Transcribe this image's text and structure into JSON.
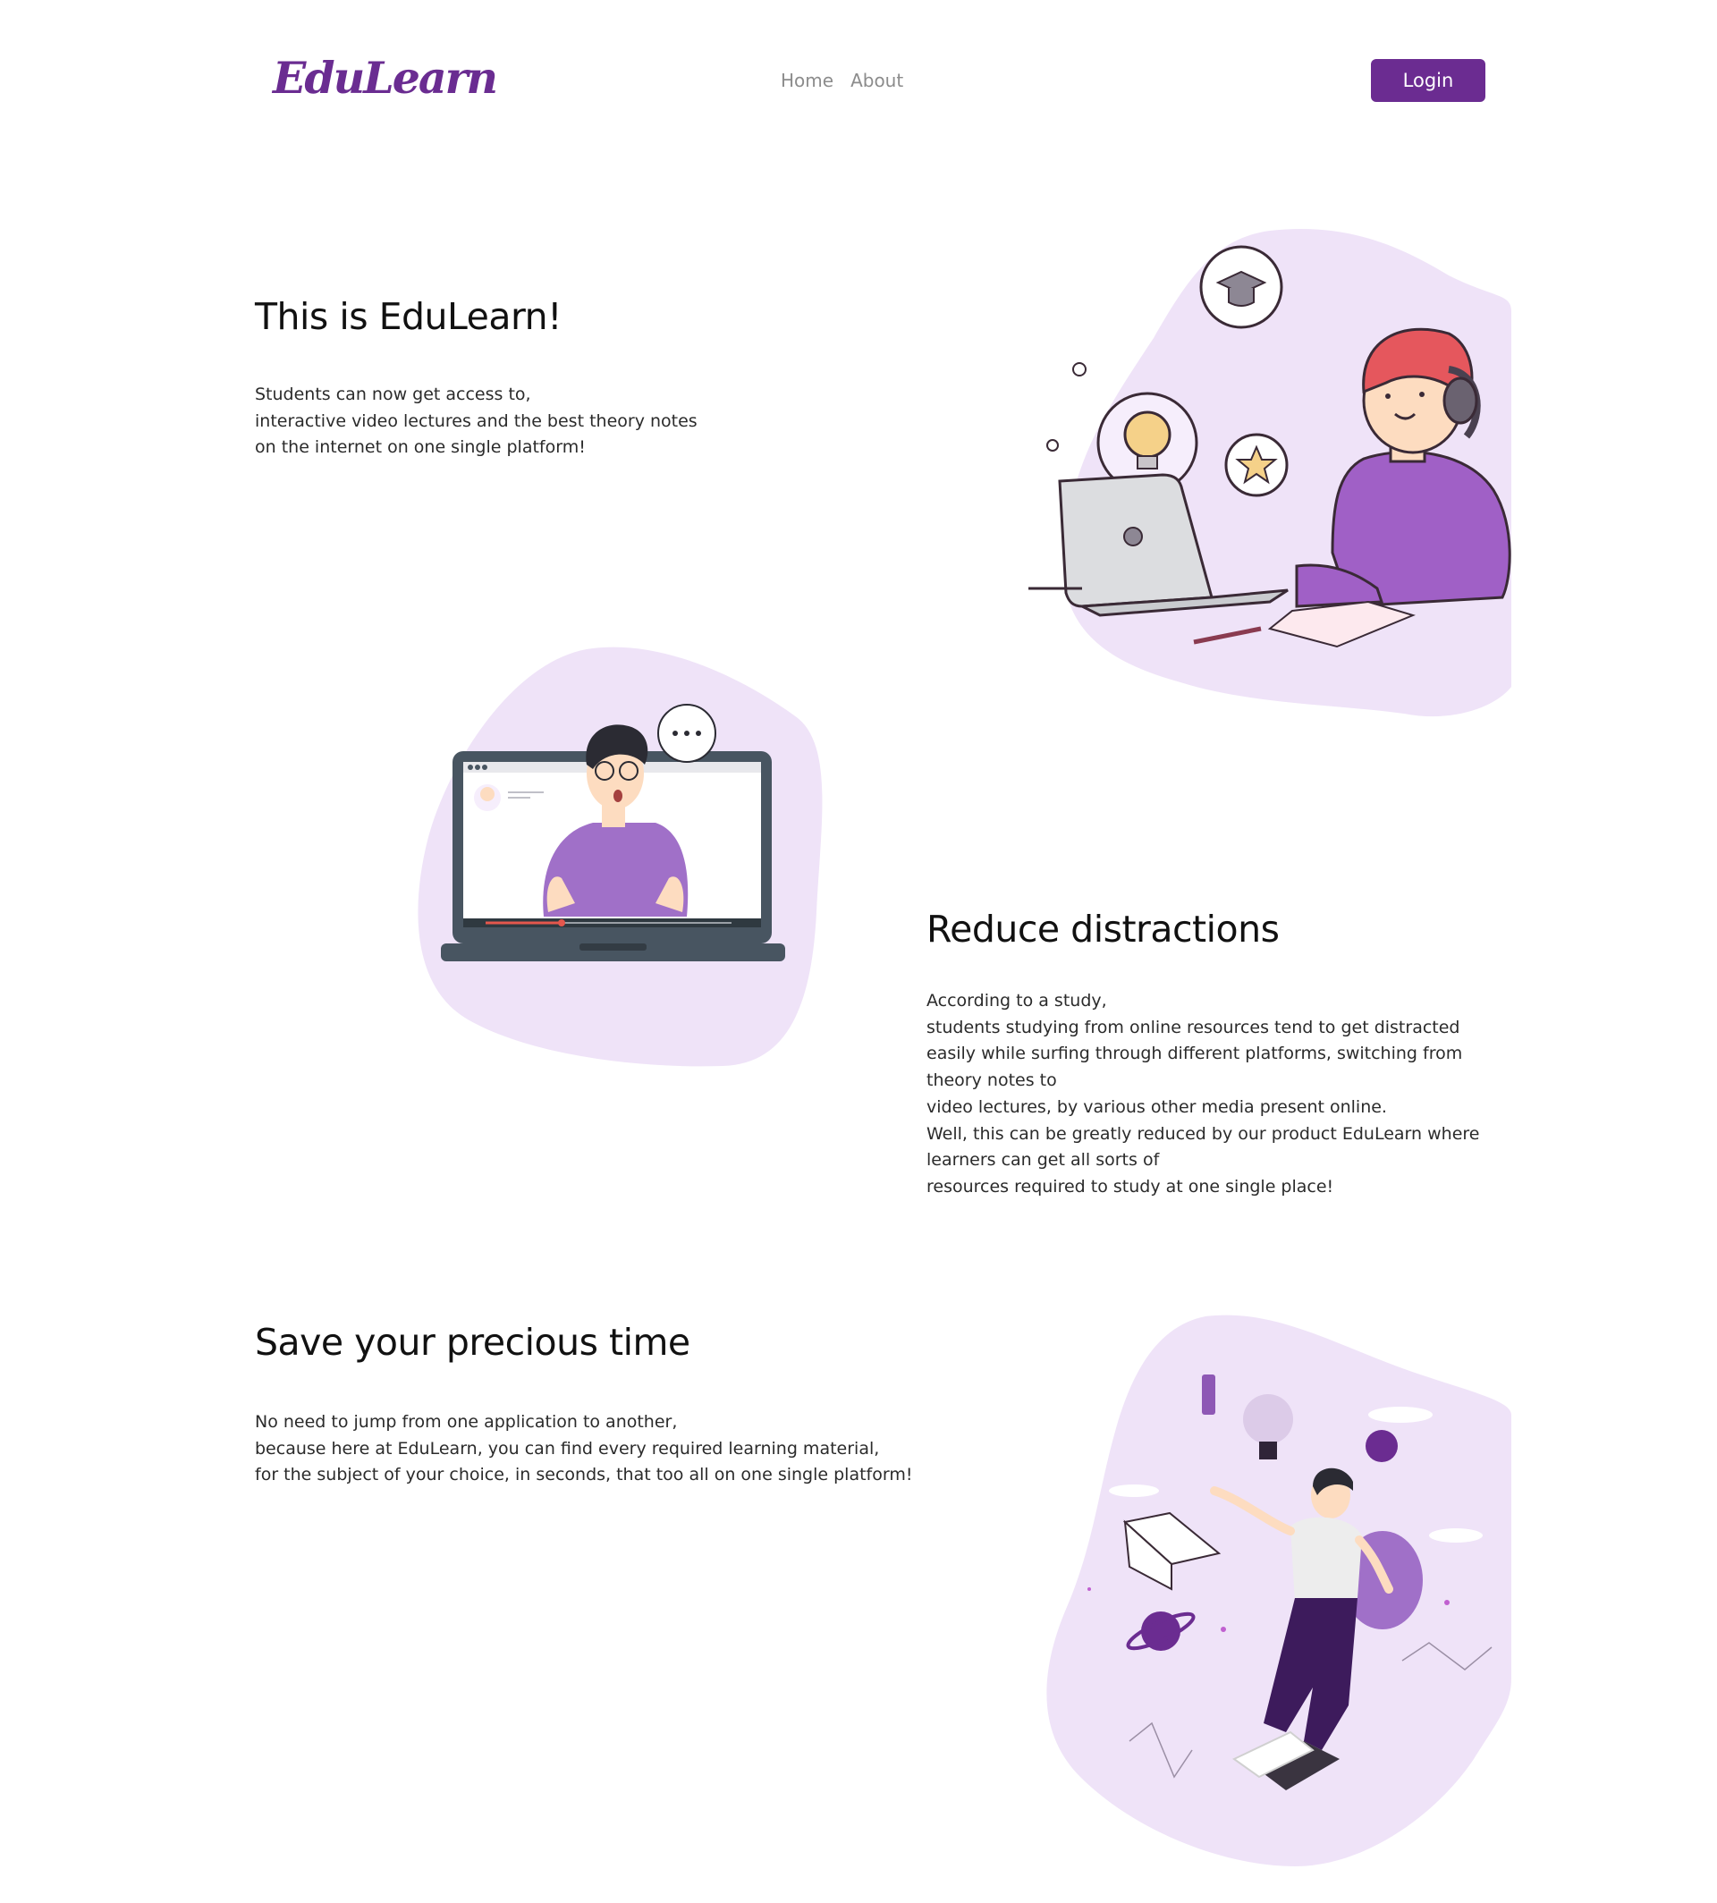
{
  "navbar": {
    "brand": "EduLearn",
    "links": [
      {
        "label": "Home"
      },
      {
        "label": "About"
      }
    ],
    "login_label": "Login",
    "accent_color": "#6b2c91"
  },
  "sections": [
    {
      "title": "This is EduLearn!",
      "lines": [
        "Students can now get access to,",
        "interactive video lectures and the best theory notes",
        "on the internet on one single platform!"
      ],
      "illustration": "student-with-headphones-at-laptop-illustration"
    },
    {
      "title": "Reduce distractions",
      "lines": [
        "According to a study,",
        "students studying from online resources tend to get distracted",
        "easily while surfing through different platforms, switching from",
        "theory notes to",
        "video lectures, by various other media present online.",
        "Well, this can be greatly reduced by our product EduLearn where",
        "learners can get all sorts of",
        "resources required to study at one single place!"
      ],
      "illustration": "video-lecture-on-laptop-illustration"
    },
    {
      "title": "Save your precious time",
      "lines": [
        "No need to jump from one application to another,",
        "because here at EduLearn, you can find every required learning material,",
        "for the subject of your choice, in seconds, that too all on one single platform!"
      ],
      "illustration": "floating-man-with-ideas-illustration"
    }
  ],
  "colors": {
    "blob": "#efe3f8",
    "purple": "#a070c8",
    "heading": "#111111"
  }
}
